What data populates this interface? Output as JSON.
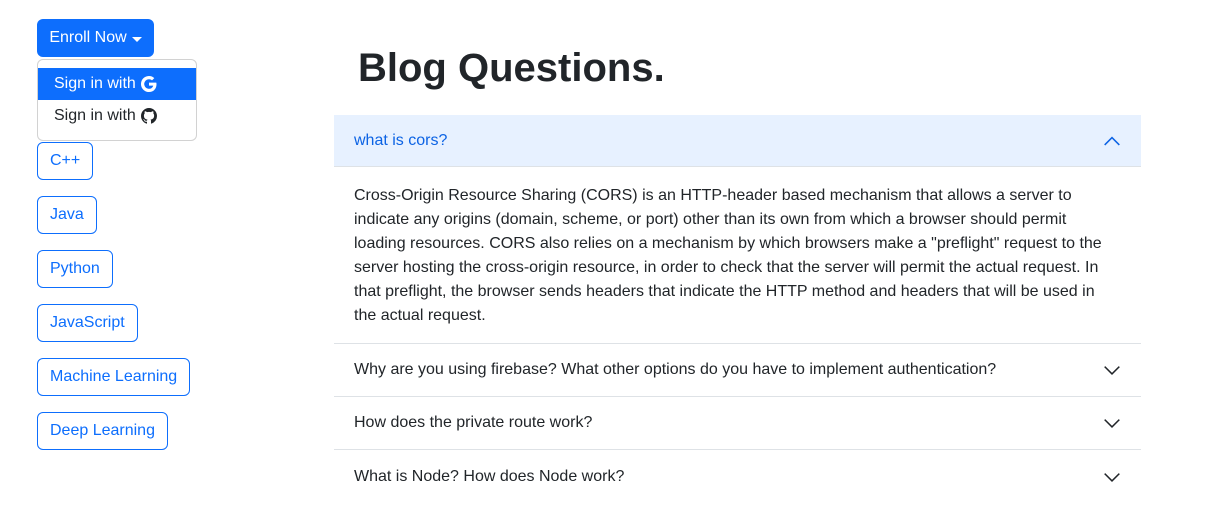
{
  "sidebar": {
    "enroll_label": "Enroll Now",
    "dropdown": [
      {
        "label": "Sign in with",
        "icon": "google-icon",
        "active": true
      },
      {
        "label": "Sign in with",
        "icon": "github-icon",
        "active": false
      }
    ],
    "courses": [
      "C++",
      "Java",
      "Python",
      "JavaScript",
      "Machine Learning",
      "Deep Learning"
    ]
  },
  "main": {
    "title": "Blog Questions.",
    "accordion": [
      {
        "question": "what is cors?",
        "expanded": true,
        "answer": "Cross-Origin Resource Sharing (CORS) is an HTTP-header based mechanism that allows a server to indicate any origins (domain, scheme, or port) other than its own from which a browser should permit loading resources. CORS also relies on a mechanism by which browsers make a \"preflight\" request to the server hosting the cross-origin resource, in order to check that the server will permit the actual request. In that preflight, the browser sends headers that indicate the HTTP method and headers that will be used in the actual request."
      },
      {
        "question": "Why are you using firebase? What other options do you have to implement authentication?",
        "expanded": false
      },
      {
        "question": "How does the private route work?",
        "expanded": false
      },
      {
        "question": "What is Node? How does Node work?",
        "expanded": false
      }
    ]
  },
  "colors": {
    "primary": "#0d6efd",
    "accordion_active_bg": "#e7f1ff",
    "accordion_active_text": "#0c63e4"
  }
}
